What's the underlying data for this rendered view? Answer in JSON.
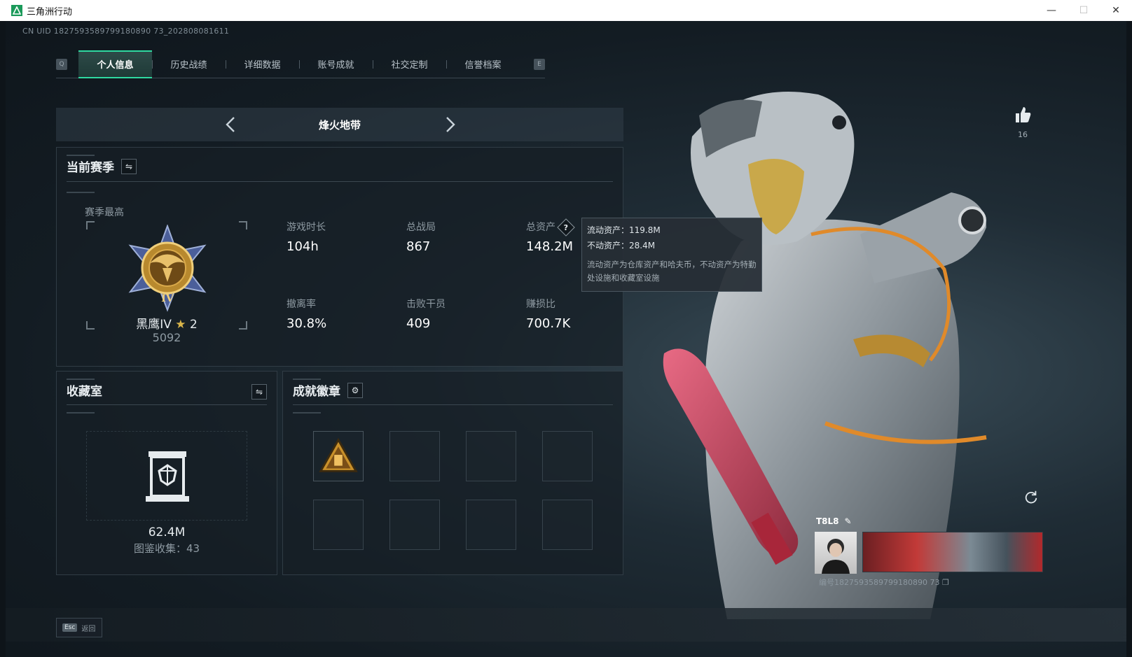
{
  "window": {
    "title": "三角洲行动",
    "minimize": "—",
    "maximize": "☐",
    "close": "✕"
  },
  "uid": "CN UID 1827593589799180890 73_202808081611",
  "tabs": {
    "left_key": "Q",
    "right_key": "E",
    "items": [
      {
        "label": "个人信息",
        "active": true
      },
      {
        "label": "历史战绩",
        "active": false
      },
      {
        "label": "详细数据",
        "active": false
      },
      {
        "label": "账号成就",
        "active": false
      },
      {
        "label": "社交定制",
        "active": false
      },
      {
        "label": "信誉档案",
        "active": false
      }
    ]
  },
  "mode": {
    "title": "烽火地带"
  },
  "season": {
    "title": "当前赛季",
    "subtitle": "赛季最高",
    "rank_name": "黑鹰IV",
    "rank_star": "★",
    "rank_stars": "2",
    "rank_points": "5092",
    "stats": [
      {
        "label": "游戏时长",
        "value": "104h"
      },
      {
        "label": "总战局",
        "value": "867"
      },
      {
        "label": "总资产",
        "value": "148.2M"
      },
      {
        "label": "撤离率",
        "value": "30.8%"
      },
      {
        "label": "击败干员",
        "value": "409"
      },
      {
        "label": "赚损比",
        "value": "700.7K"
      }
    ]
  },
  "tooltip": {
    "liquid": "流动资产：119.8M",
    "fixed": "不动资产：28.4M",
    "note": "流动资产为仓库资产和哈夫币，不动资产为特勤处设施和收藏室设施"
  },
  "collection": {
    "title": "收藏室",
    "value": "62.4M",
    "count": "图鉴收集：43"
  },
  "achievements": {
    "title": "成就徽章"
  },
  "likes": {
    "count": "16"
  },
  "player": {
    "name": "T8L8",
    "id": "编号1827593589799180890 73"
  },
  "esc": {
    "key": "Esc",
    "label": "返回"
  },
  "colors": {
    "accent": "#2fd8a0",
    "background": "#131c23"
  }
}
